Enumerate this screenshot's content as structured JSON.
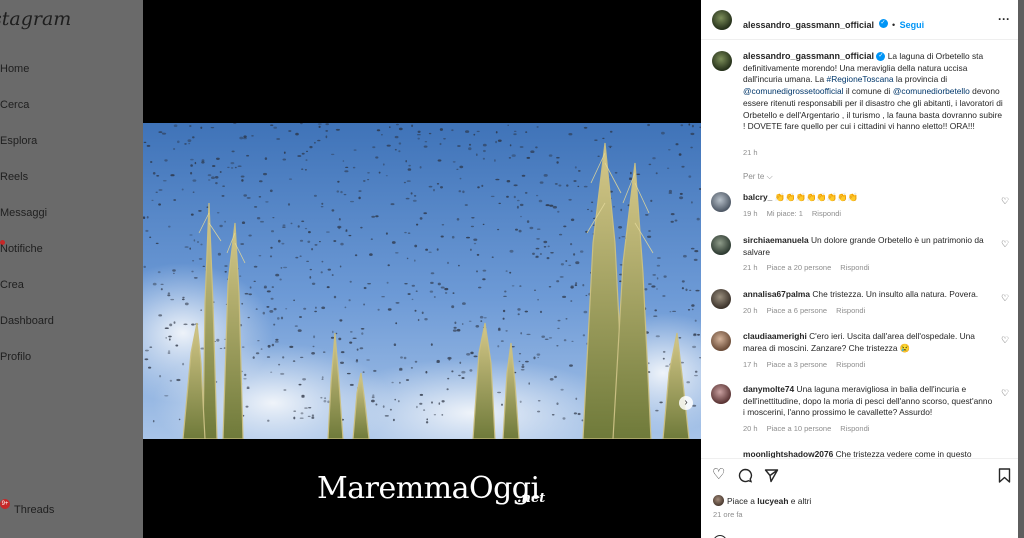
{
  "sidebar": {
    "brand": "stagram",
    "items": [
      {
        "label": "Home",
        "icon": "home-icon"
      },
      {
        "label": "Cerca",
        "icon": "search-icon"
      },
      {
        "label": "Esplora",
        "icon": "compass-icon"
      },
      {
        "label": "Reels",
        "icon": "reels-icon"
      },
      {
        "label": "Messaggi",
        "icon": "messenger-icon"
      },
      {
        "label": "Notifiche",
        "icon": "heart-icon"
      },
      {
        "label": "Crea",
        "icon": "plus-square-icon"
      },
      {
        "label": "Dashboard",
        "icon": "dashboard-icon"
      },
      {
        "label": "Profilo",
        "icon": "profile-icon"
      }
    ],
    "threads": {
      "label": "Threads",
      "badge": "9+"
    }
  },
  "media": {
    "watermark": "MaremmaOggi",
    "watermark_suffix": ".net",
    "next_icon": "chevron-right-icon",
    "carousel_count": 10,
    "carousel_active": 1
  },
  "post": {
    "author": "alessandro_gassmann_official",
    "follow_label": "Segui",
    "more_label": "···",
    "caption": {
      "user": "alessandro_gassmann_official",
      "text_1": " La laguna di Orbetello sta definitivamente morendo! Una meraviglia della natura uccisa dall'incuria umana. La ",
      "hashtag": "#RegioneToscana",
      "text_2": " la provincia di ",
      "mention_1": "@comunedigrossetoofficial",
      "text_3": " il comune di ",
      "mention_2": "@comunediorbetello",
      "text_4": " devono essere ritenuti responsabili per il disastro che gli abitanti, i lavoratori di Orbetello e dell'Argentario , il turismo , la fauna basta dovranno subire ! DOVETE fare quello per cui i cittadini vi hanno eletto!! ORA!!!"
    },
    "caption_time": "21 h",
    "translate_label": "Per te ⌵",
    "comments": [
      {
        "user": "balcry_",
        "text": " 👏👏👏👏👏👏👏👏",
        "time": "19 h",
        "likes": "Mi piace: 1",
        "reply": "Rispondi"
      },
      {
        "user": "sirchiaemanuela",
        "text": " Un dolore grande Orbetello è un patrimonio da salvare",
        "time": "21 h",
        "likes": "Piace a 20 persone",
        "reply": "Rispondi"
      },
      {
        "user": "annalisa67palma",
        "text": " Che tristezza. Un insulto alla natura. Povera.",
        "time": "20 h",
        "likes": "Piace a 6 persone",
        "reply": "Rispondi"
      },
      {
        "user": "claudiaamerighi",
        "text": " C'ero ieri. Uscita dall'area dell'ospedale. Una marea di moscini. Zanzare? Che tristezza 😢",
        "time": "17 h",
        "likes": "Piace a 3 persone",
        "reply": "Rispondi"
      },
      {
        "user": "danymolte74",
        "text": " Una laguna meravigliosa in balia dell'incuria e dell'inettitudine, dopo la moria di pesci dell'anno scorso, quest'anno i moscerini, l'anno prossimo le cavallette? Assurdo!",
        "time": "20 h",
        "likes": "Piace a 10 persone",
        "reply": "Rispondi"
      },
      {
        "user": "moonlightshadow2076",
        "text": " Che tristezza vedere come in questo",
        "time": "",
        "likes": "",
        "reply": ""
      }
    ],
    "liked_by": "Piace a ",
    "liked_user": "lucyeah",
    "liked_rest": " e altri",
    "posted_time": "21 ore fa"
  }
}
